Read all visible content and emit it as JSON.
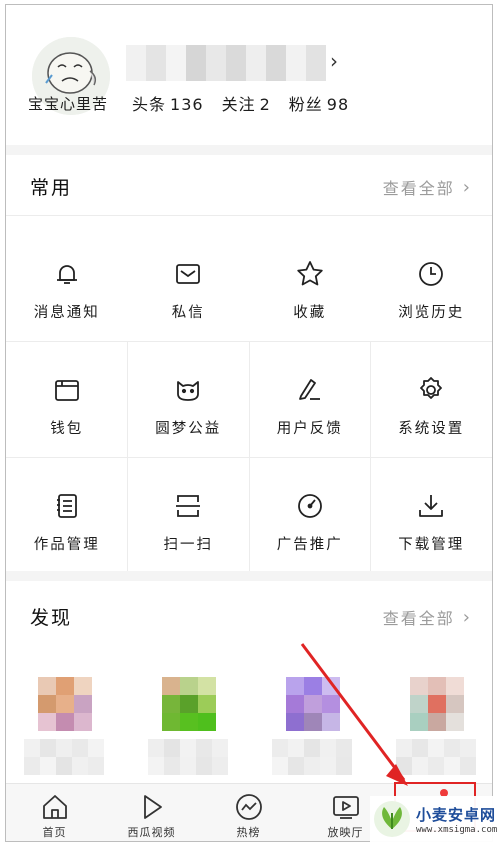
{
  "profile": {
    "avatar_caption": "宝宝心里苦",
    "stats": [
      {
        "label": "头条",
        "value": "136"
      },
      {
        "label": "关注",
        "value": "2"
      },
      {
        "label": "粉丝",
        "value": "98"
      }
    ]
  },
  "common": {
    "title": "常用",
    "view_all": "查看全部",
    "items": [
      {
        "label": "消息通知",
        "icon": "bell-icon"
      },
      {
        "label": "私信",
        "icon": "mail-icon"
      },
      {
        "label": "收藏",
        "icon": "star-icon"
      },
      {
        "label": "浏览历史",
        "icon": "clock-icon"
      },
      {
        "label": "钱包",
        "icon": "wallet-icon"
      },
      {
        "label": "圆梦公益",
        "icon": "charity-icon"
      },
      {
        "label": "用户反馈",
        "icon": "feedback-pen-icon"
      },
      {
        "label": "系统设置",
        "icon": "gear-icon"
      },
      {
        "label": "作品管理",
        "icon": "document-icon"
      },
      {
        "label": "扫一扫",
        "icon": "scan-icon"
      },
      {
        "label": "广告推广",
        "icon": "gauge-icon"
      },
      {
        "label": "下载管理",
        "icon": "download-icon"
      }
    ]
  },
  "discover": {
    "title": "发现",
    "view_all": "查看全部"
  },
  "bottom_nav": {
    "tabs": [
      {
        "label": "首页",
        "icon": "home-icon"
      },
      {
        "label": "西瓜视频",
        "icon": "play-icon"
      },
      {
        "label": "热榜",
        "icon": "trend-icon"
      },
      {
        "label": "放映厅",
        "icon": "tv-play-icon"
      }
    ]
  },
  "watermark": {
    "title": "小麦安卓网",
    "url": "www.xmsigma.com"
  },
  "colors": {
    "accent_red": "#e02424",
    "muted_text": "#9b9b9b",
    "watermark_blue": "#1e4d9a"
  }
}
